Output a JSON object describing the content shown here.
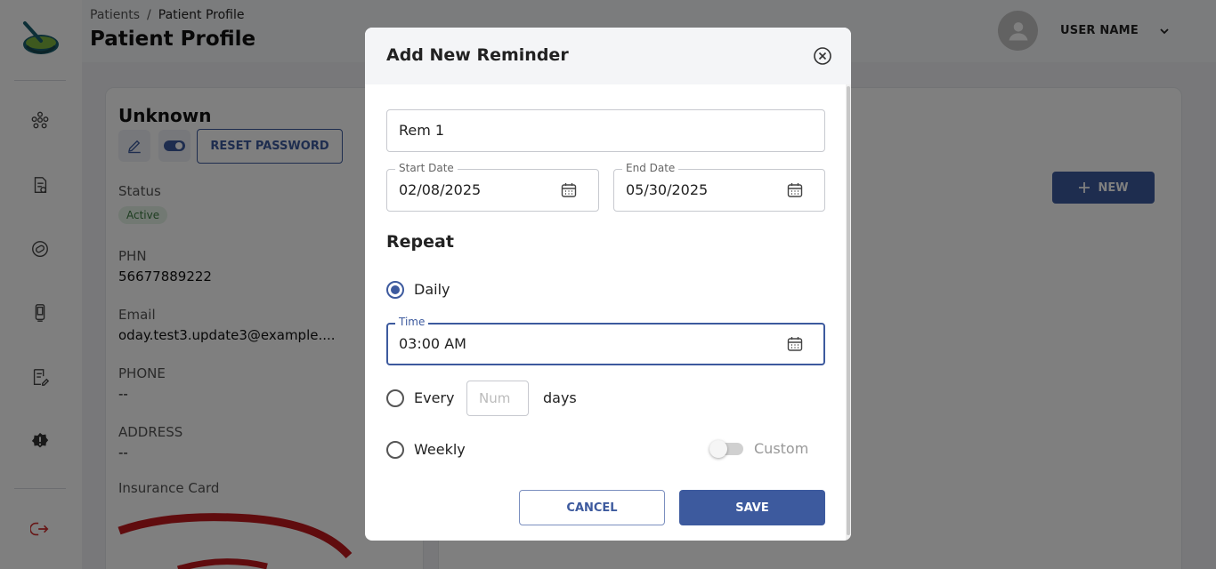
{
  "breadcrumb": {
    "parent": "Patients",
    "current": "Patient Profile"
  },
  "page_title": "Patient Profile",
  "user": {
    "name": "USER NAME"
  },
  "patient": {
    "name": "Unknown",
    "reset_password_label": "RESET PASSWORD",
    "status_label": "Status",
    "status_value": "Active",
    "phn_label": "PHN",
    "phn_value": "56677889222",
    "email_label": "Email",
    "email_value": "oday.test3.update3@example....",
    "phone_label": "PHONE",
    "phone_value": "--",
    "address_label": "ADDRESS",
    "address_value": "--",
    "insurance_label": "Insurance Card"
  },
  "new_button_label": "NEW",
  "modal": {
    "title": "Add New Reminder",
    "name_value": "Rem 1",
    "start_date_label": "Start Date",
    "start_date_value": "02/08/2025",
    "end_date_label": "End Date",
    "end_date_value": "05/30/2025",
    "repeat_title": "Repeat",
    "daily_label": "Daily",
    "time_label": "Time",
    "time_value": "03:00 AM",
    "every_label": "Every",
    "num_placeholder": "Num",
    "days_label": "days",
    "weekly_label": "Weekly",
    "custom_label": "Custom",
    "cancel_label": "CANCEL",
    "save_label": "SAVE"
  },
  "colors": {
    "primary": "#3d5a9e",
    "badge_bg": "#e5f2e6",
    "badge_text": "#3a7a40"
  }
}
